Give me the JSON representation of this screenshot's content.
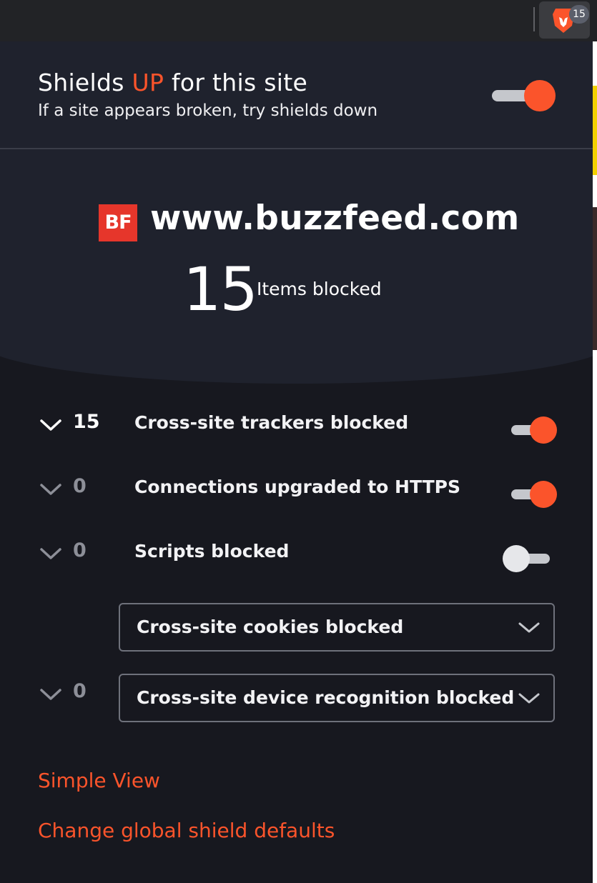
{
  "toolbar": {
    "extension_badge": "15",
    "extension_icon": "brave-lion-icon"
  },
  "header": {
    "title_prefix": "Shields ",
    "title_state": "UP",
    "title_suffix": " for this site",
    "subtitle": "If a site appears broken, try shields down",
    "shields_enabled": true
  },
  "summary": {
    "site_logo_text": "BF",
    "site": "www.buzzfeed.com",
    "blocked_count": "15",
    "blocked_label": "Items blocked"
  },
  "controls": [
    {
      "count": "15",
      "label": "Cross-site trackers blocked",
      "enabled": true
    },
    {
      "count": "0",
      "label": "Connections upgraded to HTTPS",
      "enabled": true
    },
    {
      "count": "0",
      "label": "Scripts blocked",
      "enabled": false
    }
  ],
  "selects": {
    "cookies": {
      "value": "Cross-site cookies blocked"
    },
    "fingerprinting": {
      "count": "0",
      "value": "Cross-site device recognition blocked"
    }
  },
  "links": {
    "simple_view": "Simple View",
    "global_defaults": "Change global shield defaults"
  },
  "colors": {
    "accent": "#fb542b",
    "background": "#17181f",
    "header_bg": "#1f222d"
  }
}
